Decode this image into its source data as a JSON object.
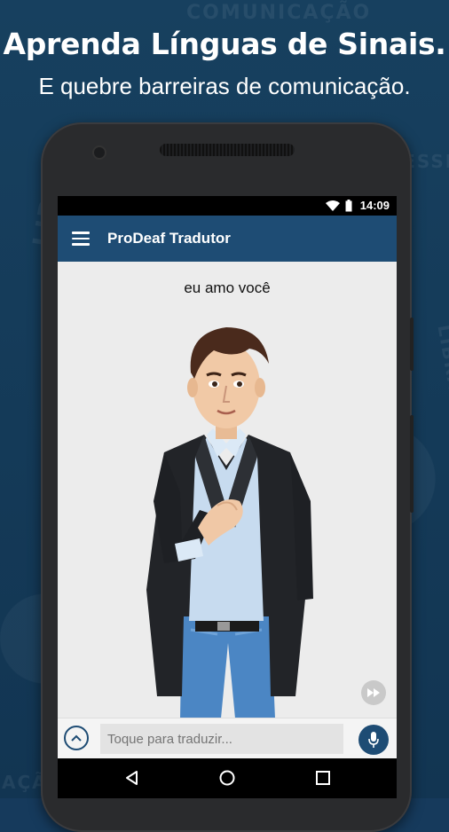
{
  "promo": {
    "headline": "Aprenda Línguas de Sinais.",
    "subline": "E quebre barreiras de comunicação."
  },
  "background_words": [
    "COMUNICAÇÃO",
    "LIBRAS",
    "ACESSIBILIDADE",
    "LIBRAS",
    "AÇÃO"
  ],
  "status_bar": {
    "time": "14:09",
    "icons": [
      "wifi-icon",
      "battery-icon"
    ]
  },
  "app_bar": {
    "title": "ProDeaf Tradutor",
    "menu_icon": "hamburger-menu-icon"
  },
  "content": {
    "phrase": "eu amo você",
    "replay_icon": "fast-forward-icon"
  },
  "input_bar": {
    "placeholder": "Toque para traduzir...",
    "expand_icon": "chevron-up-icon",
    "mic_icon": "microphone-icon"
  },
  "nav_bar": {
    "icons": [
      "back-icon",
      "home-icon",
      "recents-icon"
    ]
  },
  "colors": {
    "background": "#163a5c",
    "app_bar": "#1e4c74",
    "accent": "#1e4c74",
    "screen": "#ececec"
  }
}
